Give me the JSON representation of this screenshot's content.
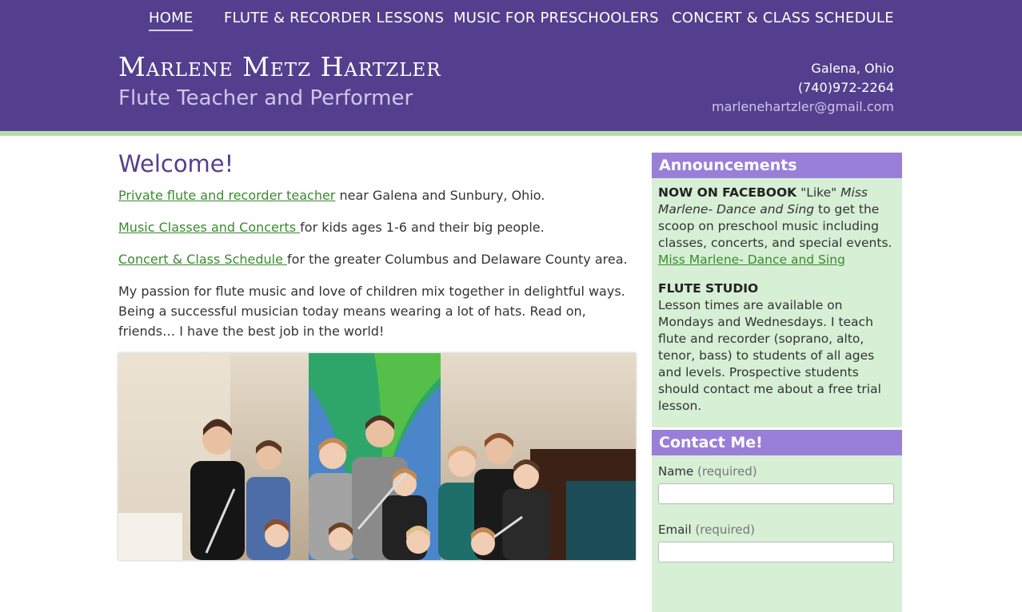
{
  "nav": {
    "items": [
      {
        "label": "HOME"
      },
      {
        "label": "FLUTE & RECORDER LESSONS"
      },
      {
        "label": "MUSIC FOR PRESCHOOLERS"
      },
      {
        "label": "CONCERT & CLASS SCHEDULE"
      }
    ]
  },
  "site": {
    "title": "Marlene Metz Hartzler",
    "subtitle": "Flute Teacher and Performer"
  },
  "contact_info": {
    "location": "Galena, Ohio",
    "phone": "(740)972-2264",
    "email": "marlenehartzler@gmail.com"
  },
  "main": {
    "heading": "Welcome!",
    "p1_link": "Private flute and recorder teacher",
    "p1_text": " near Galena and Sunbury, Ohio.",
    "p2_link": "Music Classes and Concerts ",
    "p2_text": "for kids ages 1-6 and their big people.",
    "p3_link": "Concert & Class Schedule ",
    "p3_text": "for the greater Columbus and Delaware County area.",
    "p4_text": "My passion for flute music and love of children mix together in delightful ways. Being a successful musician today means wearing a lot of hats. Read on, friends… I have the best job in the world!"
  },
  "announcements": {
    "title": "Announcements",
    "fb_heading": "NOW ON FACEBOOK",
    "fb_text1": " \"Like\" ",
    "fb_italic": "Miss Marlene- Dance and Sing",
    "fb_text2": " to get the scoop on preschool music including classes, concerts, and special events.",
    "fb_link": "Miss Marlene- Dance and Sing",
    "studio_heading": "FLUTE STUDIO",
    "studio_text": "Lesson times are available on Mondays and Wednesdays. I teach flute and recorder (soprano, alto, tenor, bass) to students of all ages and levels. Prospective students should contact me about a free trial lesson."
  },
  "contact_form": {
    "title": "Contact Me!",
    "name_label": "Name",
    "email_label": "Email",
    "required_label": "(required)"
  },
  "colors": {
    "header_bg": "#533f8e",
    "accent_green": "#b5dca8",
    "widget_title_bg": "#9a7fd8",
    "widget_bg": "#d6efd5",
    "link": "#3a8a2e"
  }
}
